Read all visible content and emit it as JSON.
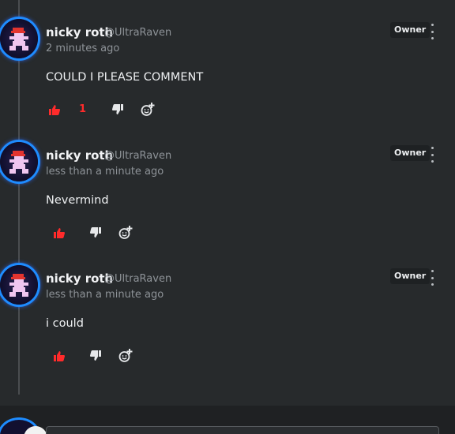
{
  "comments": [
    {
      "author": "nicky roth",
      "handle": "@UltraRaven",
      "time": "2 minutes ago",
      "badge": "Owner",
      "text": "COULD I PLEASE COMMENT",
      "likes": "1"
    },
    {
      "author": "nicky roth",
      "handle": "@UltraRaven",
      "time": "less than a minute ago",
      "badge": "Owner",
      "text": "Nevermind",
      "likes": ""
    },
    {
      "author": "nicky roth",
      "handle": "@UltraRaven",
      "time": "less than a minute ago",
      "badge": "Owner",
      "text": "i could",
      "likes": ""
    }
  ],
  "icons": {
    "like": "thumbs-up-icon",
    "dislike": "thumbs-down-icon",
    "reaction": "add-reaction-icon",
    "menu": "more-vertical-icon"
  },
  "colors": {
    "background": "#272a2c",
    "liked": "#ff2b2b",
    "avatar_ring": "#1e8cff",
    "muted_text": "#8e9398"
  }
}
